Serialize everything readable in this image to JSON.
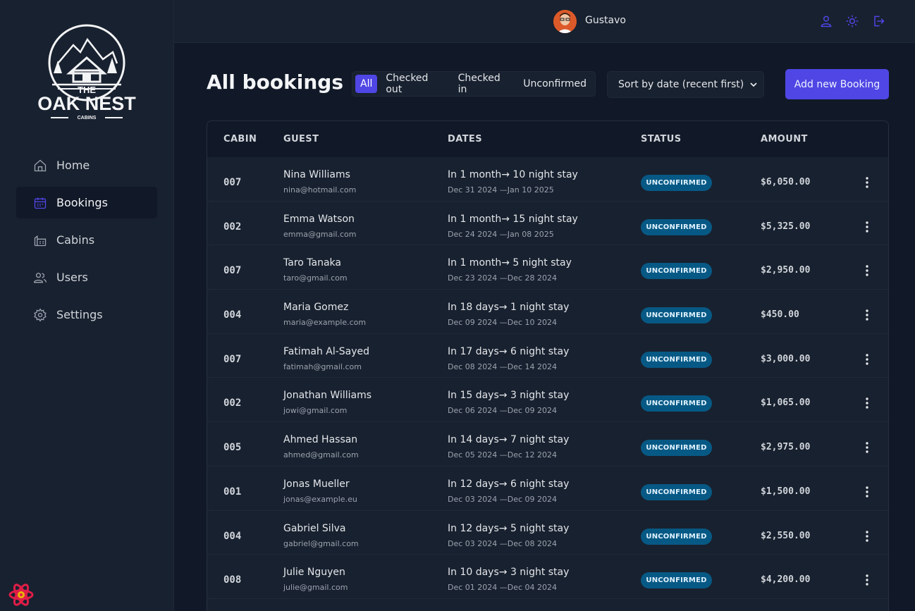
{
  "sidebar": {
    "logo": {
      "line1": "THE",
      "line2": "OAK NEST",
      "line3": "CABINS"
    },
    "items": [
      {
        "label": "Home",
        "icon": "home-icon"
      },
      {
        "label": "Bookings",
        "icon": "calendar-icon",
        "active": true
      },
      {
        "label": "Cabins",
        "icon": "cabin-icon"
      },
      {
        "label": "Users",
        "icon": "users-icon"
      },
      {
        "label": "Settings",
        "icon": "gear-icon"
      }
    ]
  },
  "header": {
    "username": "Gustavo",
    "icons": [
      "user-icon",
      "sun-icon",
      "logout-icon"
    ]
  },
  "page": {
    "title": "All bookings",
    "filters": [
      "All",
      "Checked out",
      "Checked in",
      "Unconfirmed"
    ],
    "active_filter": "All",
    "sort_value": "Sort by date (recent first)",
    "add_button": "Add new Booking"
  },
  "table": {
    "columns": [
      "CABIN",
      "GUEST",
      "DATES",
      "STATUS",
      "AMOUNT"
    ],
    "rows": [
      {
        "cabin": "007",
        "name": "Nina Williams",
        "email": "nina@hotmail.com",
        "dates_main": "In 1 month→ 10 night stay",
        "dates_range": "Dec 31 2024 —Jan 10 2025",
        "status": "UNCONFIRMED",
        "amount": "$6,050.00"
      },
      {
        "cabin": "002",
        "name": "Emma Watson",
        "email": "emma@gmail.com",
        "dates_main": "In 1 month→ 15 night stay",
        "dates_range": "Dec 24 2024 —Jan 08 2025",
        "status": "UNCONFIRMED",
        "amount": "$5,325.00"
      },
      {
        "cabin": "007",
        "name": "Taro Tanaka",
        "email": "taro@gmail.com",
        "dates_main": "In 1 month→ 5 night stay",
        "dates_range": "Dec 23 2024 —Dec 28 2024",
        "status": "UNCONFIRMED",
        "amount": "$2,950.00"
      },
      {
        "cabin": "004",
        "name": "Maria Gomez",
        "email": "maria@example.com",
        "dates_main": "In 18 days→ 1 night stay",
        "dates_range": "Dec 09 2024 —Dec 10 2024",
        "status": "UNCONFIRMED",
        "amount": "$450.00"
      },
      {
        "cabin": "007",
        "name": "Fatimah Al-Sayed",
        "email": "fatimah@gmail.com",
        "dates_main": "In 17 days→ 6 night stay",
        "dates_range": "Dec 08 2024 —Dec 14 2024",
        "status": "UNCONFIRMED",
        "amount": "$3,000.00"
      },
      {
        "cabin": "002",
        "name": "Jonathan Williams",
        "email": "jowi@gmail.com",
        "dates_main": "In 15 days→ 3 night stay",
        "dates_range": "Dec 06 2024 —Dec 09 2024",
        "status": "UNCONFIRMED",
        "amount": "$1,065.00"
      },
      {
        "cabin": "005",
        "name": "Ahmed Hassan",
        "email": "ahmed@gmail.com",
        "dates_main": "In 14 days→ 7 night stay",
        "dates_range": "Dec 05 2024 —Dec 12 2024",
        "status": "UNCONFIRMED",
        "amount": "$2,975.00"
      },
      {
        "cabin": "001",
        "name": "Jonas Mueller",
        "email": "jonas@example.eu",
        "dates_main": "In 12 days→ 6 night stay",
        "dates_range": "Dec 03 2024 —Dec 09 2024",
        "status": "UNCONFIRMED",
        "amount": "$1,500.00"
      },
      {
        "cabin": "004",
        "name": "Gabriel Silva",
        "email": "gabriel@gmail.com",
        "dates_main": "In 12 days→ 5 night stay",
        "dates_range": "Dec 03 2024 —Dec 08 2024",
        "status": "UNCONFIRMED",
        "amount": "$2,550.00"
      },
      {
        "cabin": "008",
        "name": "Julie Nguyen",
        "email": "julie@gmail.com",
        "dates_main": "In 10 days→ 3 night stay",
        "dates_range": "Dec 01 2024 —Dec 04 2024",
        "status": "UNCONFIRMED",
        "amount": "$4,200.00"
      }
    ]
  },
  "colors": {
    "accent": "#4f46e5",
    "badge_bg": "#075985",
    "sidebar_bg": "#18212f",
    "page_bg": "#111827"
  }
}
